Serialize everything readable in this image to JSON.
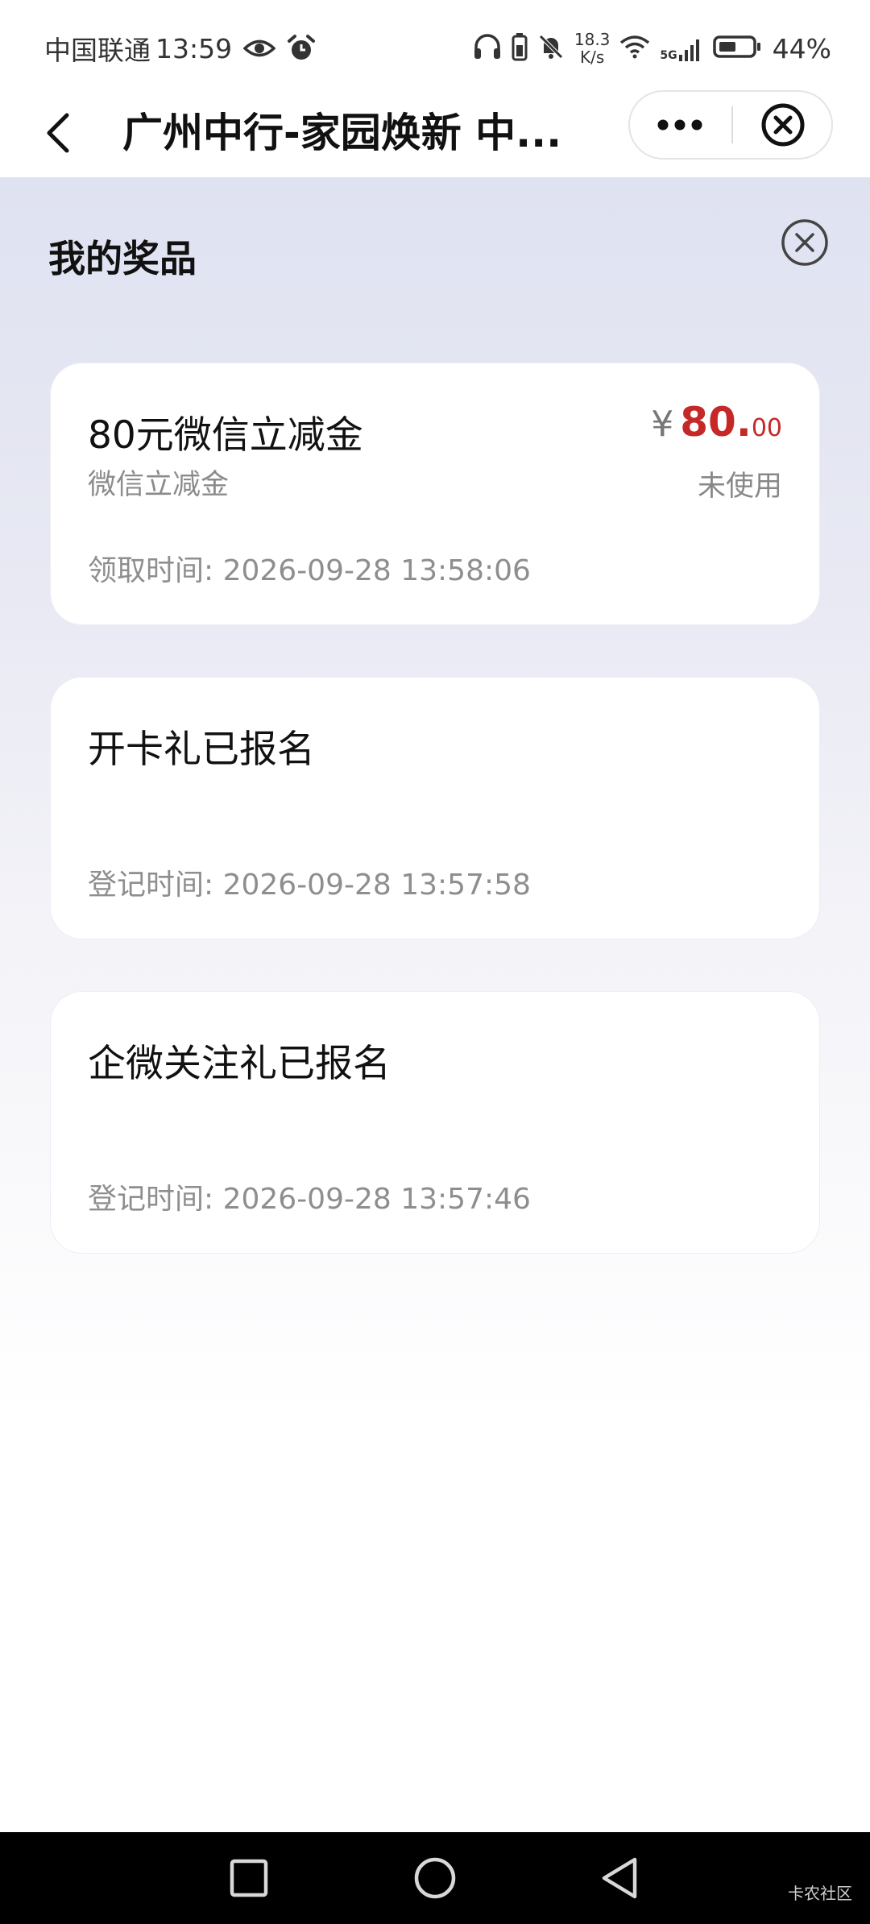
{
  "status_bar": {
    "carrier": "中国联通",
    "time": "13:59",
    "net_speed_value": "18.3",
    "net_speed_unit": "K/s",
    "network": "5G",
    "battery_percent": "44%"
  },
  "title_bar": {
    "title": "广州中行-家园焕新 中..."
  },
  "panel": {
    "title": "我的奖品"
  },
  "prizes": [
    {
      "title": "80元微信立减金",
      "subtitle": "微信立减金",
      "currency": "¥",
      "amount_int": "80.",
      "amount_dec": "00",
      "status": "未使用",
      "time": "领取时间: 2026-09-28 13:58:06"
    },
    {
      "title": "开卡礼已报名",
      "time": "登记时间: 2026-09-28 13:57:58"
    },
    {
      "title": "企微关注礼已报名",
      "time": "登记时间: 2026-09-28 13:57:46"
    }
  ],
  "watermark": "卡农社区",
  "colors": {
    "price_red": "#c62828",
    "muted_text": "#8e8e8e",
    "nav_bar": "#000000"
  }
}
